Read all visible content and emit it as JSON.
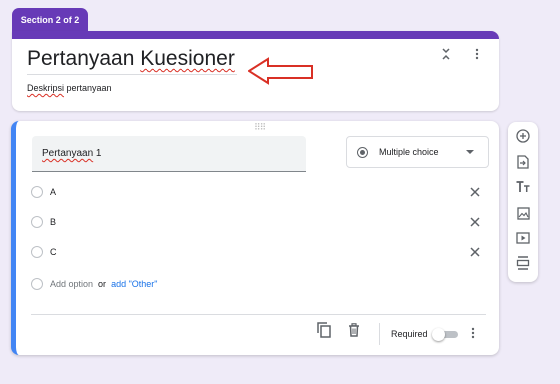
{
  "section_tab": {
    "label": "Section 2 of 2"
  },
  "form_header": {
    "title_part1": "Pertanyaan ",
    "title_part2": "Kuesioner",
    "description_part1": "Deskripsi",
    "description_part2": " pertanyaan"
  },
  "question": {
    "title_part1": "Pertanyaan",
    "title_part2": " 1",
    "type_label": "Multiple choice",
    "options": [
      "A",
      "B",
      "C"
    ],
    "add_option_label": "Add option",
    "or_label": "or",
    "add_other_label": "add \"Other\"",
    "required_label": "Required",
    "required": false
  },
  "colors": {
    "accent": "#673ab7",
    "active_border": "#4285f4",
    "link": "#1a73e8",
    "annotation_arrow": "#d93025"
  }
}
